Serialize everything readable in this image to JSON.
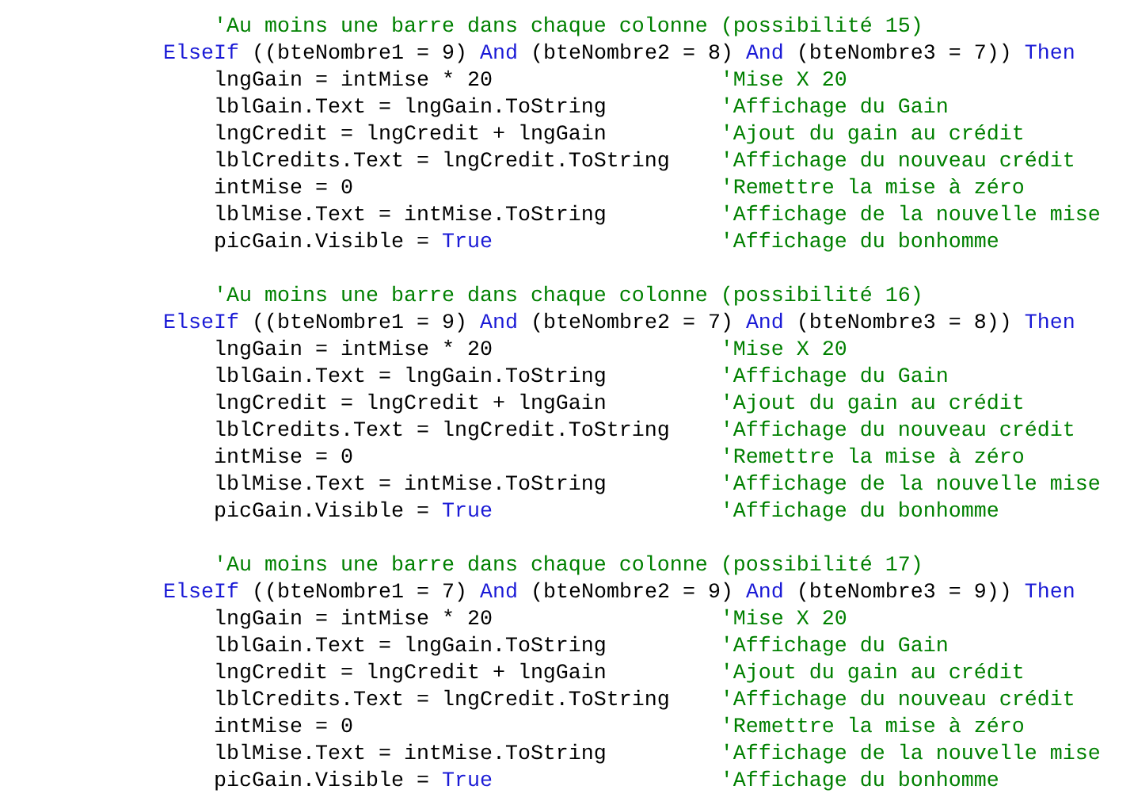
{
  "blocks": [
    {
      "comment": "'Au moins une barre dans chaque colonne (possibilité 15)",
      "condition": [
        {
          "kind": "keyword",
          "text": "ElseIf"
        },
        {
          "kind": "code",
          "text": " ((bteNombre1 = 9) "
        },
        {
          "kind": "keyword",
          "text": "And"
        },
        {
          "kind": "code",
          "text": " (bteNombre2 = 8) "
        },
        {
          "kind": "keyword",
          "text": "And"
        },
        {
          "kind": "code",
          "text": " (bteNombre3 = 7)) "
        },
        {
          "kind": "keyword",
          "text": "Then"
        }
      ],
      "statements": [
        {
          "code": [
            {
              "kind": "code",
              "text": "lngGain = intMise * 20"
            }
          ],
          "comment": "'Mise X 20"
        },
        {
          "code": [
            {
              "kind": "code",
              "text": "lblGain.Text = lngGain.ToString"
            }
          ],
          "comment": "'Affichage du Gain"
        },
        {
          "code": [
            {
              "kind": "code",
              "text": "lngCredit = lngCredit + lngGain"
            }
          ],
          "comment": "'Ajout du gain au crédit"
        },
        {
          "code": [
            {
              "kind": "code",
              "text": "lblCredits.Text = lngCredit.ToString"
            }
          ],
          "comment": "'Affichage du nouveau crédit"
        },
        {
          "code": [
            {
              "kind": "code",
              "text": "intMise = 0"
            }
          ],
          "comment": "'Remettre la mise à zéro"
        },
        {
          "code": [
            {
              "kind": "code",
              "text": "lblMise.Text = intMise.ToString"
            }
          ],
          "comment": "'Affichage de la nouvelle mise"
        },
        {
          "code": [
            {
              "kind": "code",
              "text": "picGain.Visible = "
            },
            {
              "kind": "keyword",
              "text": "True"
            }
          ],
          "comment": "'Affichage du bonhomme"
        }
      ]
    },
    {
      "comment": "'Au moins une barre dans chaque colonne (possibilité 16)",
      "condition": [
        {
          "kind": "keyword",
          "text": "ElseIf"
        },
        {
          "kind": "code",
          "text": " ((bteNombre1 = 9) "
        },
        {
          "kind": "keyword",
          "text": "And"
        },
        {
          "kind": "code",
          "text": " (bteNombre2 = 7) "
        },
        {
          "kind": "keyword",
          "text": "And"
        },
        {
          "kind": "code",
          "text": " (bteNombre3 = 8)) "
        },
        {
          "kind": "keyword",
          "text": "Then"
        }
      ],
      "statements": [
        {
          "code": [
            {
              "kind": "code",
              "text": "lngGain = intMise * 20"
            }
          ],
          "comment": "'Mise X 20"
        },
        {
          "code": [
            {
              "kind": "code",
              "text": "lblGain.Text = lngGain.ToString"
            }
          ],
          "comment": "'Affichage du Gain"
        },
        {
          "code": [
            {
              "kind": "code",
              "text": "lngCredit = lngCredit + lngGain"
            }
          ],
          "comment": "'Ajout du gain au crédit"
        },
        {
          "code": [
            {
              "kind": "code",
              "text": "lblCredits.Text = lngCredit.ToString"
            }
          ],
          "comment": "'Affichage du nouveau crédit"
        },
        {
          "code": [
            {
              "kind": "code",
              "text": "intMise = 0"
            }
          ],
          "comment": "'Remettre la mise à zéro"
        },
        {
          "code": [
            {
              "kind": "code",
              "text": "lblMise.Text = intMise.ToString"
            }
          ],
          "comment": "'Affichage de la nouvelle mise"
        },
        {
          "code": [
            {
              "kind": "code",
              "text": "picGain.Visible = "
            },
            {
              "kind": "keyword",
              "text": "True"
            }
          ],
          "comment": "'Affichage du bonhomme"
        }
      ]
    },
    {
      "comment": "'Au moins une barre dans chaque colonne (possibilité 17)",
      "condition": [
        {
          "kind": "keyword",
          "text": "ElseIf"
        },
        {
          "kind": "code",
          "text": " ((bteNombre1 = 7) "
        },
        {
          "kind": "keyword",
          "text": "And"
        },
        {
          "kind": "code",
          "text": " (bteNombre2 = 9) "
        },
        {
          "kind": "keyword",
          "text": "And"
        },
        {
          "kind": "code",
          "text": " (bteNombre3 = 9)) "
        },
        {
          "kind": "keyword",
          "text": "Then"
        }
      ],
      "statements": [
        {
          "code": [
            {
              "kind": "code",
              "text": "lngGain = intMise * 20"
            }
          ],
          "comment": "'Mise X 20"
        },
        {
          "code": [
            {
              "kind": "code",
              "text": "lblGain.Text = lngGain.ToString"
            }
          ],
          "comment": "'Affichage du Gain"
        },
        {
          "code": [
            {
              "kind": "code",
              "text": "lngCredit = lngCredit + lngGain"
            }
          ],
          "comment": "'Ajout du gain au crédit"
        },
        {
          "code": [
            {
              "kind": "code",
              "text": "lblCredits.Text = lngCredit.ToString"
            }
          ],
          "comment": "'Affichage du nouveau crédit"
        },
        {
          "code": [
            {
              "kind": "code",
              "text": "intMise = 0"
            }
          ],
          "comment": "'Remettre la mise à zéro"
        },
        {
          "code": [
            {
              "kind": "code",
              "text": "lblMise.Text = intMise.ToString"
            }
          ],
          "comment": "'Affichage de la nouvelle mise"
        },
        {
          "code": [
            {
              "kind": "code",
              "text": "picGain.Visible = "
            },
            {
              "kind": "keyword",
              "text": "True"
            }
          ],
          "comment": "'Affichage du bonhomme"
        }
      ]
    }
  ]
}
